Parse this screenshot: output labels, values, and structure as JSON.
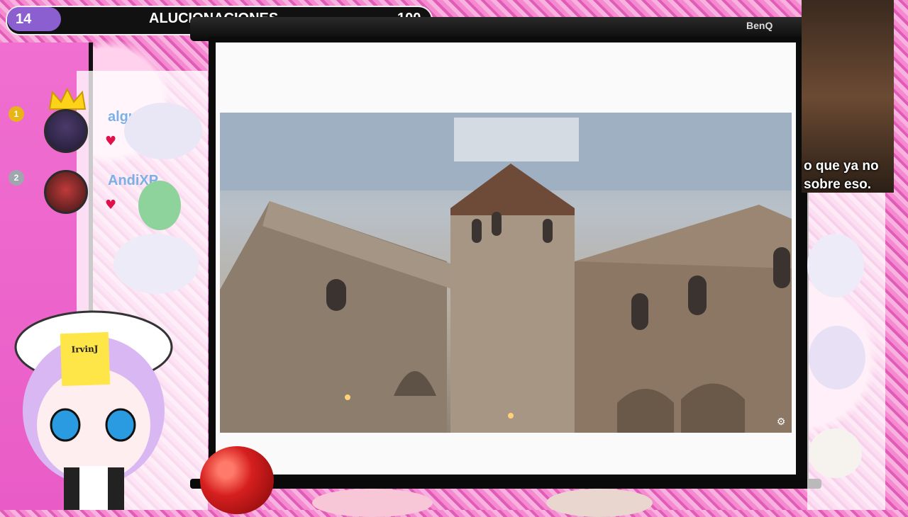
{
  "stats_bar": {
    "level": "14",
    "title": "ALUCIONACIONES",
    "value": "100"
  },
  "projector": {
    "brand": "BenQ"
  },
  "leaderboard": [
    {
      "rank": "1",
      "name": "alguien_xd"
    },
    {
      "rank": "2",
      "name": "AndiXP"
    }
  ],
  "mascot": {
    "note": "IrvinJ"
  },
  "camera": {
    "subtitle_line1": "o que ya no",
    "subtitle_line2": "sobre eso."
  },
  "colors": {
    "level_pill": "#8b5fcf",
    "username": "#7ab0e6",
    "heart": "#e0104a",
    "panel_pink": "#f06fd0"
  }
}
